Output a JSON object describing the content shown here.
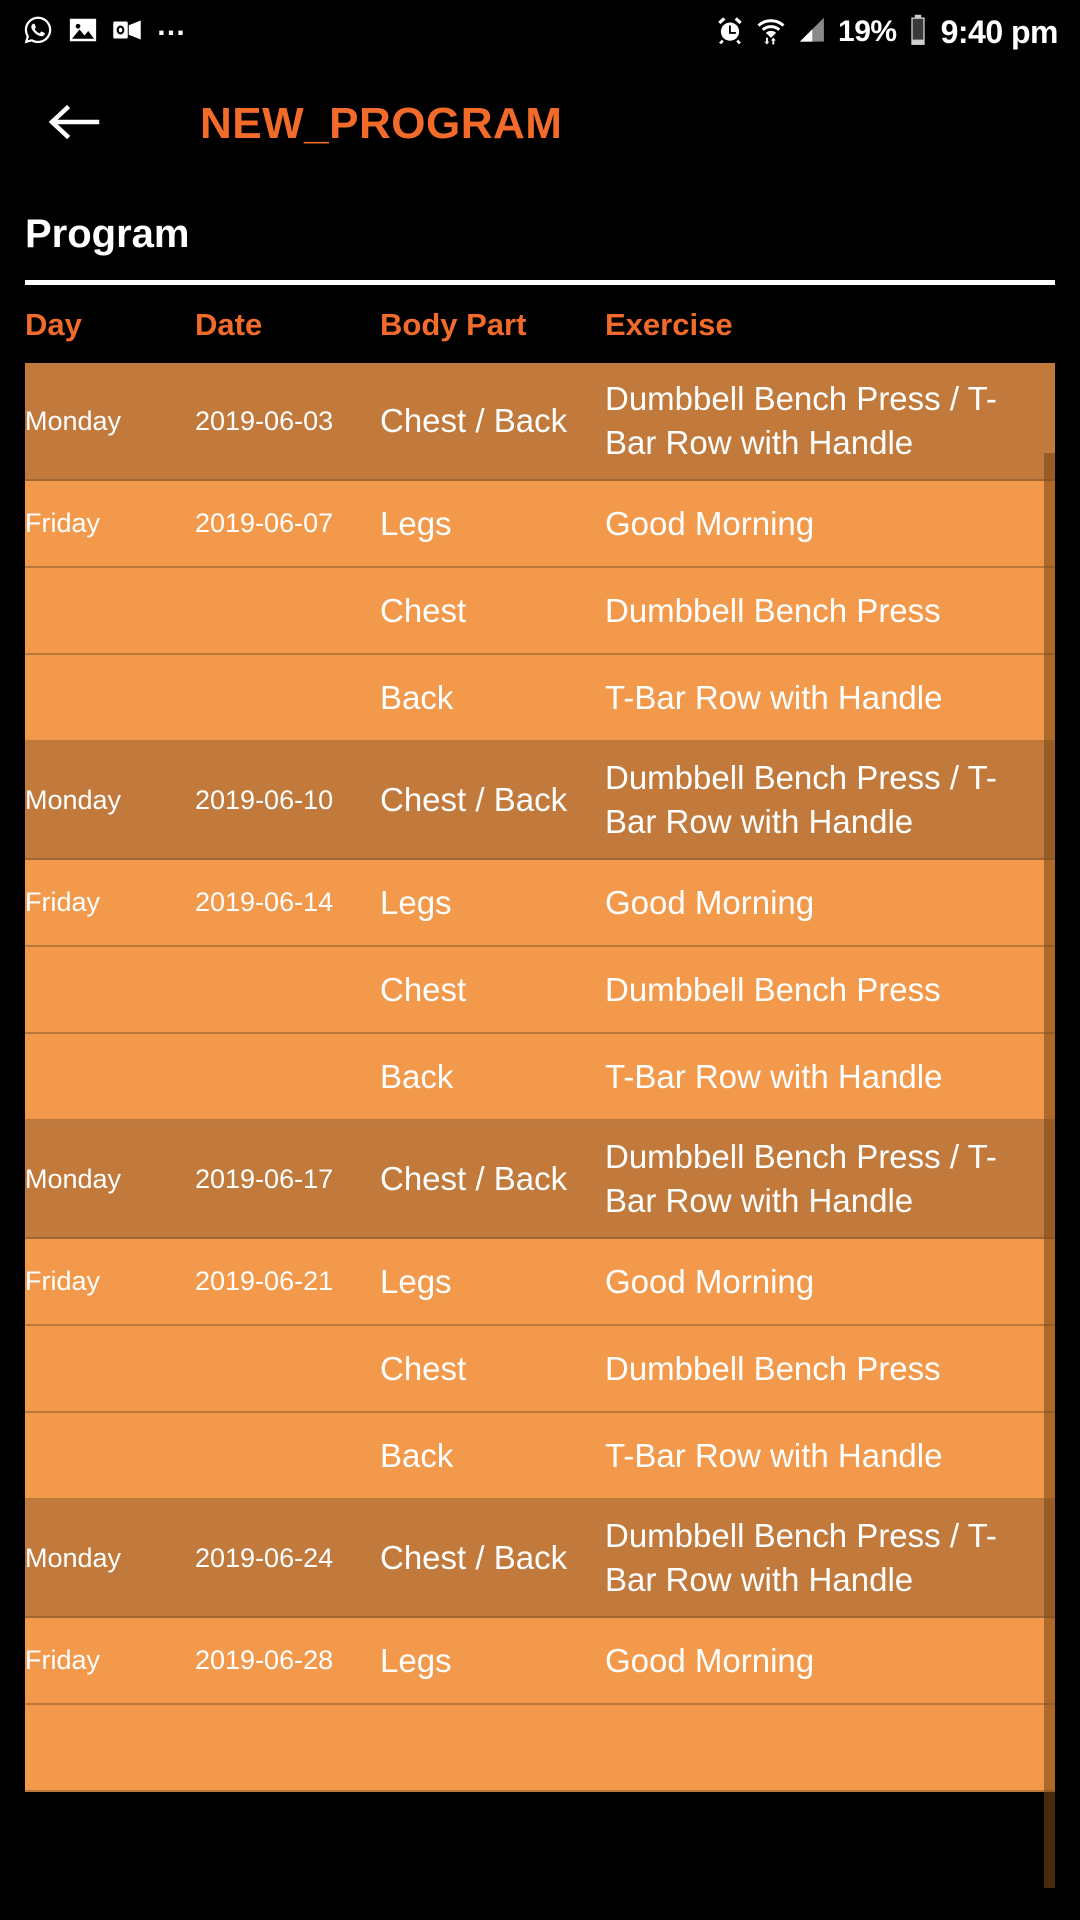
{
  "status_bar": {
    "left_icons": [
      "whatsapp-icon",
      "gallery-icon",
      "outlook-icon"
    ],
    "overflow": "…",
    "right_icons": [
      "alarm-icon",
      "wifi-icon",
      "cellular-signal-icon",
      "battery-icon"
    ],
    "battery_percent": "19%",
    "time": "9:40 pm"
  },
  "app_bar": {
    "back_icon": "back-arrow-icon",
    "title": "NEW_PROGRAM",
    "title_color": "#F26B2A"
  },
  "section": {
    "title": "Program"
  },
  "table": {
    "columns": [
      "Day",
      "Date",
      "Body Part",
      "Exercise"
    ],
    "header_color": "#F26B2A",
    "row_dark_color": "#C17A3C",
    "row_light_color": "#F3994B",
    "rows": [
      {
        "day": "Monday",
        "date": "2019-06-03",
        "body_part": "Chest / Back",
        "exercise": "Dumbbell Bench Press / T-Bar Row with Handle",
        "tone": "dark"
      },
      {
        "day": "Friday",
        "date": "2019-06-07",
        "body_part": "Legs",
        "exercise": "Good Morning",
        "tone": "light"
      },
      {
        "day": "",
        "date": "",
        "body_part": "Chest",
        "exercise": "Dumbbell Bench Press",
        "tone": "light"
      },
      {
        "day": "",
        "date": "",
        "body_part": "Back",
        "exercise": "T-Bar Row with Handle",
        "tone": "light"
      },
      {
        "day": "Monday",
        "date": "2019-06-10",
        "body_part": "Chest / Back",
        "exercise": "Dumbbell Bench Press / T-Bar Row with Handle",
        "tone": "dark"
      },
      {
        "day": "Friday",
        "date": "2019-06-14",
        "body_part": "Legs",
        "exercise": "Good Morning",
        "tone": "light"
      },
      {
        "day": "",
        "date": "",
        "body_part": "Chest",
        "exercise": "Dumbbell Bench Press",
        "tone": "light"
      },
      {
        "day": "",
        "date": "",
        "body_part": "Back",
        "exercise": "T-Bar Row with Handle",
        "tone": "light"
      },
      {
        "day": "Monday",
        "date": "2019-06-17",
        "body_part": "Chest / Back",
        "exercise": "Dumbbell Bench Press / T-Bar Row with Handle",
        "tone": "dark"
      },
      {
        "day": "Friday",
        "date": "2019-06-21",
        "body_part": "Legs",
        "exercise": "Good Morning",
        "tone": "light"
      },
      {
        "day": "",
        "date": "",
        "body_part": "Chest",
        "exercise": "Dumbbell Bench Press",
        "tone": "light"
      },
      {
        "day": "",
        "date": "",
        "body_part": "Back",
        "exercise": "T-Bar Row with Handle",
        "tone": "light"
      },
      {
        "day": "Monday",
        "date": "2019-06-24",
        "body_part": "Chest / Back",
        "exercise": "Dumbbell Bench Press / T-Bar Row with Handle",
        "tone": "dark"
      },
      {
        "day": "Friday",
        "date": "2019-06-28",
        "body_part": "Legs",
        "exercise": "Good Morning",
        "tone": "light"
      },
      {
        "day": "",
        "date": "",
        "body_part": "",
        "exercise": "",
        "tone": "light"
      }
    ]
  }
}
